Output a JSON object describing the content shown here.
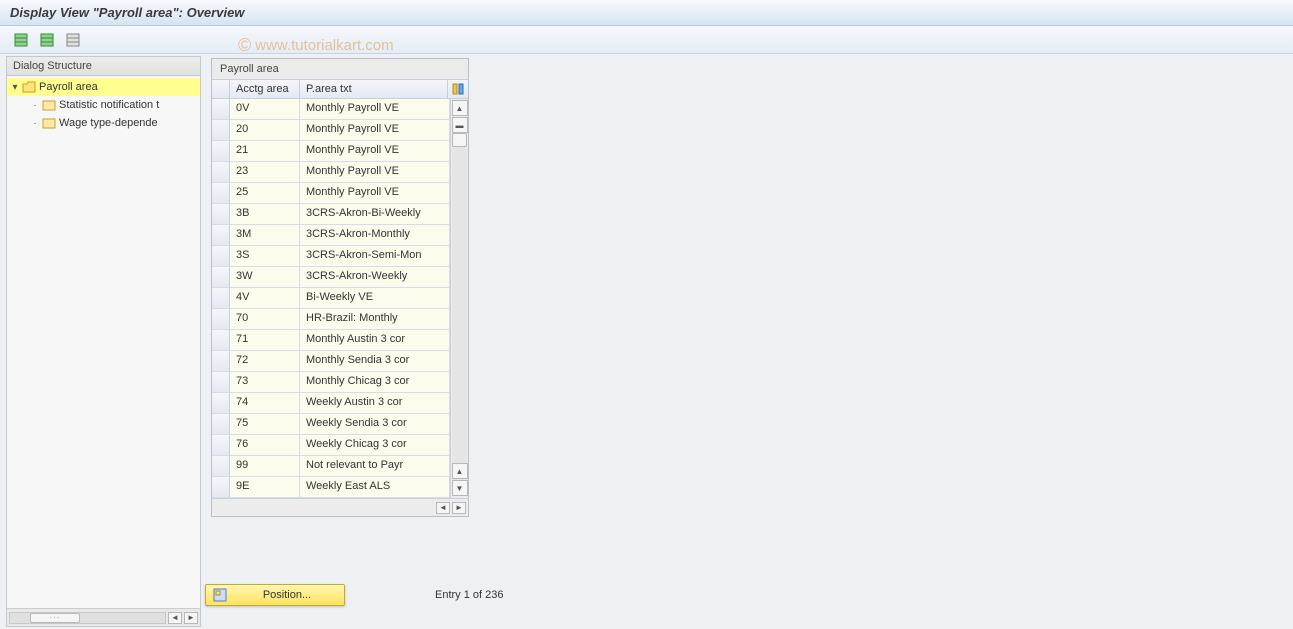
{
  "title": "Display View \"Payroll area\": Overview",
  "watermark": "www.tutorialkart.com",
  "tree": {
    "header": "Dialog Structure",
    "root": {
      "label": "Payroll area",
      "open": true
    },
    "children": [
      {
        "label": "Statistic notification t"
      },
      {
        "label": "Wage type-depende"
      }
    ]
  },
  "table": {
    "caption": "Payroll area",
    "headers": {
      "a": "Acctg area",
      "b": "P.area txt"
    },
    "rows": [
      {
        "a": "0V",
        "b": "Monthly Payroll  VE"
      },
      {
        "a": "20",
        "b": "Monthly Payroll  VE"
      },
      {
        "a": "21",
        "b": "Monthly Payroll  VE"
      },
      {
        "a": "23",
        "b": "Monthly Payroll  VE"
      },
      {
        "a": "25",
        "b": "Monthly Payroll  VE"
      },
      {
        "a": "3B",
        "b": "3CRS-Akron-Bi-Weekly"
      },
      {
        "a": "3M",
        "b": "3CRS-Akron-Monthly"
      },
      {
        "a": "3S",
        "b": "3CRS-Akron-Semi-Mon"
      },
      {
        "a": "3W",
        "b": "3CRS-Akron-Weekly"
      },
      {
        "a": "4V",
        "b": "Bi-Weekly VE"
      },
      {
        "a": "70",
        "b": "HR-Brazil: Monthly"
      },
      {
        "a": "71",
        "b": "Monthly Austin 3 cor"
      },
      {
        "a": "72",
        "b": "Monthly Sendia 3 cor"
      },
      {
        "a": "73",
        "b": "Monthly Chicag 3 cor"
      },
      {
        "a": "74",
        "b": "Weekly Austin 3 cor"
      },
      {
        "a": "75",
        "b": "Weekly Sendia 3 cor"
      },
      {
        "a": "76",
        "b": "Weekly Chicag 3 cor"
      },
      {
        "a": "99",
        "b": "Not relevant to Payr"
      },
      {
        "a": "9E",
        "b": "Weekly East ALS"
      }
    ]
  },
  "footer": {
    "position_label": "Position...",
    "entry_text": "Entry 1 of 236"
  }
}
